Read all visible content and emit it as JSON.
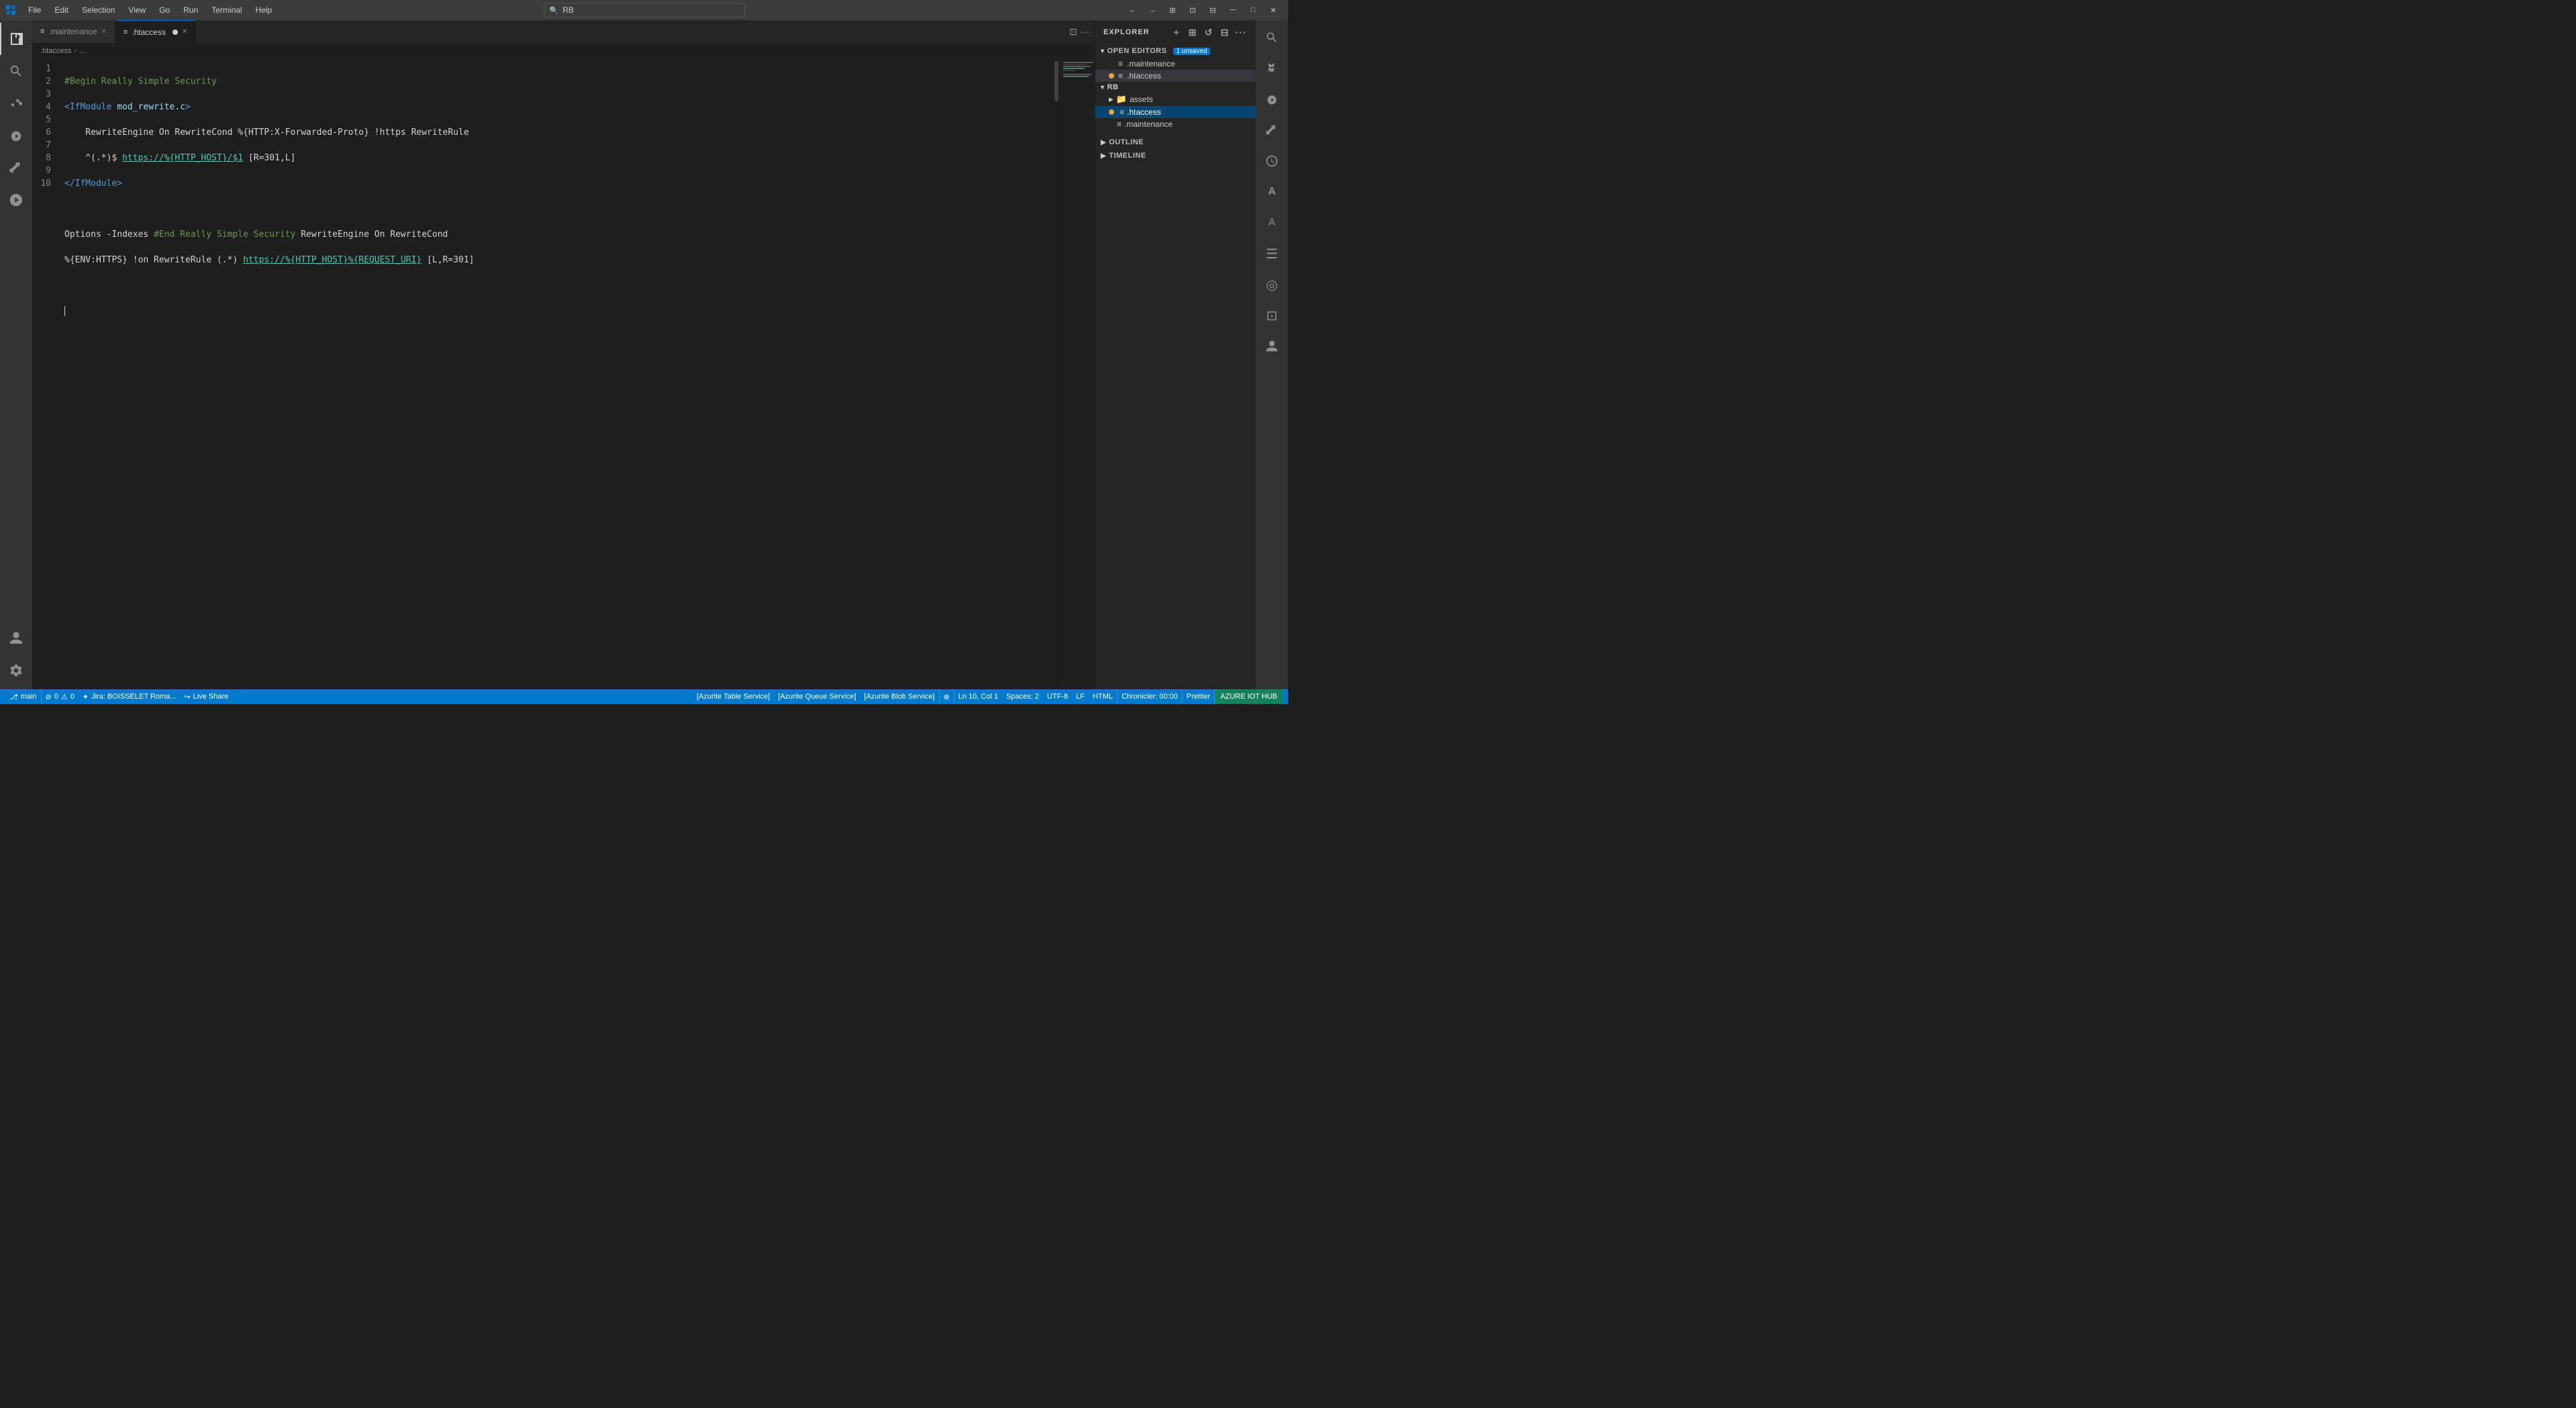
{
  "titlebar": {
    "menus": [
      "File",
      "Edit",
      "Selection",
      "View",
      "Go",
      "Run",
      "Terminal",
      "Help"
    ],
    "search": {
      "value": "RB",
      "placeholder": "RB"
    },
    "window_controls": [
      "⊟",
      "❐",
      "✕"
    ]
  },
  "tabs": [
    {
      "id": "maintenance",
      "label": ".maintenance",
      "active": false,
      "unsaved": false,
      "icon": "≡"
    },
    {
      "id": "htaccess",
      "label": ".htaccess",
      "active": true,
      "unsaved": true,
      "icon": "●"
    }
  ],
  "breadcrumb": {
    "items": [
      ".htaccess",
      "..."
    ]
  },
  "editor": {
    "file": ".htaccess",
    "lines": [
      {
        "num": 1,
        "content": "#Begin Really Simple Security",
        "type": "comment"
      },
      {
        "num": 2,
        "content": "<IfModule mod_rewrite.c>",
        "type": "tag"
      },
      {
        "num": 3,
        "content": "    RewriteEngine On RewriteCond %{HTTP:X-Forwarded-Proto} !https RewriteRule",
        "type": "normal"
      },
      {
        "num": 4,
        "content": "    ^(.*)$ https://%{HTTP_HOST}/$1 [R=301,L]",
        "type": "link"
      },
      {
        "num": 5,
        "content": "</IfModule>",
        "type": "tag"
      },
      {
        "num": 6,
        "content": "",
        "type": "normal"
      },
      {
        "num": 7,
        "content": "Options -Indexes #End Really Simple Security RewriteEngine On RewriteCond",
        "type": "mixed"
      },
      {
        "num": 8,
        "content": "%{ENV:HTTPS} !on RewriteRule (.*) https://%{HTTP_HOST}%{REQUEST_URI} [L,R=301]",
        "type": "link2"
      },
      {
        "num": 9,
        "content": "",
        "type": "normal"
      },
      {
        "num": 10,
        "content": "",
        "type": "normal"
      }
    ],
    "cursor": {
      "line": 10,
      "col": 1
    }
  },
  "sidebar": {
    "title": "EXPLORER",
    "open_editors": {
      "label": "OPEN EDITORS",
      "badge": "1 unsaved",
      "files": [
        {
          "name": ".maintenance",
          "unsaved": false
        },
        {
          "name": ".htaccess",
          "unsaved": true,
          "active": true
        }
      ]
    },
    "explorer": {
      "root": "RB",
      "items": [
        {
          "type": "folder",
          "name": "assets",
          "level": 1,
          "expanded": false
        },
        {
          "type": "file",
          "name": ".htaccess",
          "level": 1,
          "active": true
        },
        {
          "type": "file",
          "name": ".maintenance",
          "level": 1
        }
      ]
    },
    "outline_label": "OUTLINE",
    "timeline_label": "TIMELINE"
  },
  "right_icons": [
    "search",
    "source-control",
    "run-debug",
    "extensions",
    "remote-explorer",
    "accounts",
    "settings"
  ],
  "status_bar": {
    "left": [
      {
        "id": "git",
        "icon": "⎇",
        "text": "main"
      },
      {
        "id": "errors",
        "icon": "⊘",
        "text": "0"
      },
      {
        "id": "warnings",
        "icon": "⚠",
        "text": "0"
      },
      {
        "id": "jira",
        "icon": "✦",
        "text": "Jira: BOISSELET Roma..."
      }
    ],
    "live_share": {
      "icon": "↪",
      "text": "Live Share"
    },
    "right": [
      {
        "id": "azurite-table",
        "text": "[Azurite Table Service]"
      },
      {
        "id": "azurite-queue",
        "text": "[Azurite Queue Service]"
      },
      {
        "id": "azurite-blob",
        "text": "[Azurite Blob Service]"
      },
      {
        "id": "encoding",
        "icon": "⊕",
        "text": ""
      },
      {
        "id": "line-col",
        "text": "Ln 10, Col 1"
      },
      {
        "id": "spaces",
        "text": "Spaces: 2"
      },
      {
        "id": "encoding-label",
        "text": "UTF-8"
      },
      {
        "id": "line-ending",
        "text": "LF"
      },
      {
        "id": "language",
        "text": "HTML"
      },
      {
        "id": "prettier",
        "text": "Prettier"
      }
    ],
    "azure_iot": {
      "text": "AZURE IOT HUB"
    },
    "chronicler": {
      "text": "Chronicler: 00:00"
    }
  }
}
